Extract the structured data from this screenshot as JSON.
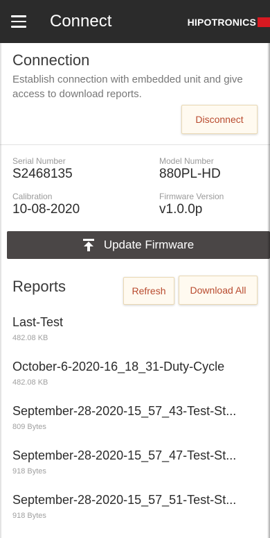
{
  "header": {
    "title": "Connect",
    "brand": "HIPOTRONICS",
    "brand_color": "#d71921",
    "menu_icon": "hamburger-icon"
  },
  "connection": {
    "title": "Connection",
    "description": "Establish connection with embedded unit and give access to download reports.",
    "disconnect_label": "Disconnect"
  },
  "device": {
    "serial_label": "Serial Number",
    "serial_value": "S2468135",
    "model_label": "Model Number",
    "model_value": "880PL-HD",
    "calibration_label": "Calibration",
    "calibration_value": "10-08-2020",
    "firmware_label": "Firmware Version",
    "firmware_value": "v1.0.0p"
  },
  "update": {
    "label": "Update Firmware",
    "icon": "upload-icon"
  },
  "reports": {
    "title": "Reports",
    "refresh_label": "Refresh",
    "download_all_label": "Download All",
    "items": [
      {
        "name": "Last-Test",
        "size": "482.08 KB"
      },
      {
        "name": "October-6-2020-16_18_31-Duty-Cycle",
        "size": "482.08 KB"
      },
      {
        "name": "September-28-2020-15_57_43-Test-St...",
        "size": "809 Bytes"
      },
      {
        "name": "September-28-2020-15_57_47-Test-St...",
        "size": "918 Bytes"
      },
      {
        "name": "September-28-2020-15_57_51-Test-St...",
        "size": "918 Bytes"
      }
    ]
  },
  "colors": {
    "topbar": "#2b2b2b",
    "update_bar": "#4a4646",
    "button_text": "#b84a2e",
    "button_bg": "#fffaf0"
  }
}
